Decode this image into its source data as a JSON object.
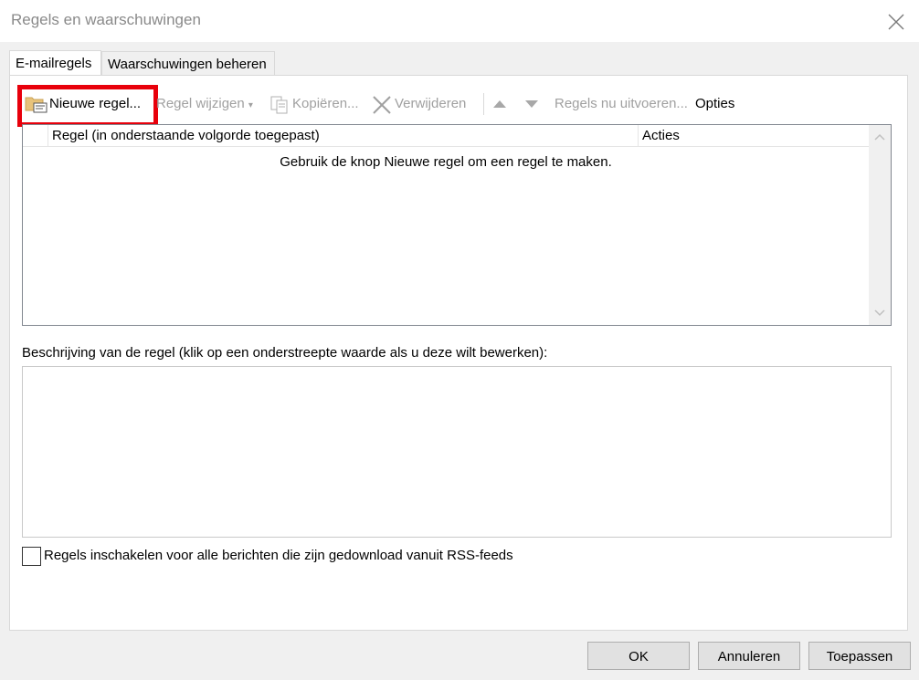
{
  "window": {
    "title": "Regels en waarschuwingen",
    "close_icon": "close-icon"
  },
  "tabs": [
    {
      "label": "E-mailregels",
      "active": true
    },
    {
      "label": "Waarschuwingen beheren",
      "active": false
    }
  ],
  "toolbar": {
    "new_rule": "Nieuwe regel...",
    "change_rule": "Regel wijzigen",
    "copy": "Kopiëren...",
    "delete": "Verwijderen",
    "move_up_icon": "arrow-up-icon",
    "move_down_icon": "arrow-down-icon",
    "run_rules": "Regels nu uitvoeren...",
    "options": "Opties"
  },
  "rules_list": {
    "columns": [
      "Regel (in onderstaande volgorde toegepast)",
      "Acties"
    ],
    "empty_message": "Gebruik de knop Nieuwe regel om een regel te maken."
  },
  "description": {
    "label": "Beschrijving van de regel (klik op een onderstreepte waarde als u deze wilt bewerken):"
  },
  "rss": {
    "label": "Regels inschakelen voor alle berichten die zijn gedownload vanuit RSS-feeds",
    "checked": false
  },
  "buttons": {
    "ok": "OK",
    "cancel": "Annuleren",
    "apply": "Toepassen"
  },
  "colors": {
    "highlight": "#e8000b",
    "disabled_text": "#a0a0a0"
  }
}
